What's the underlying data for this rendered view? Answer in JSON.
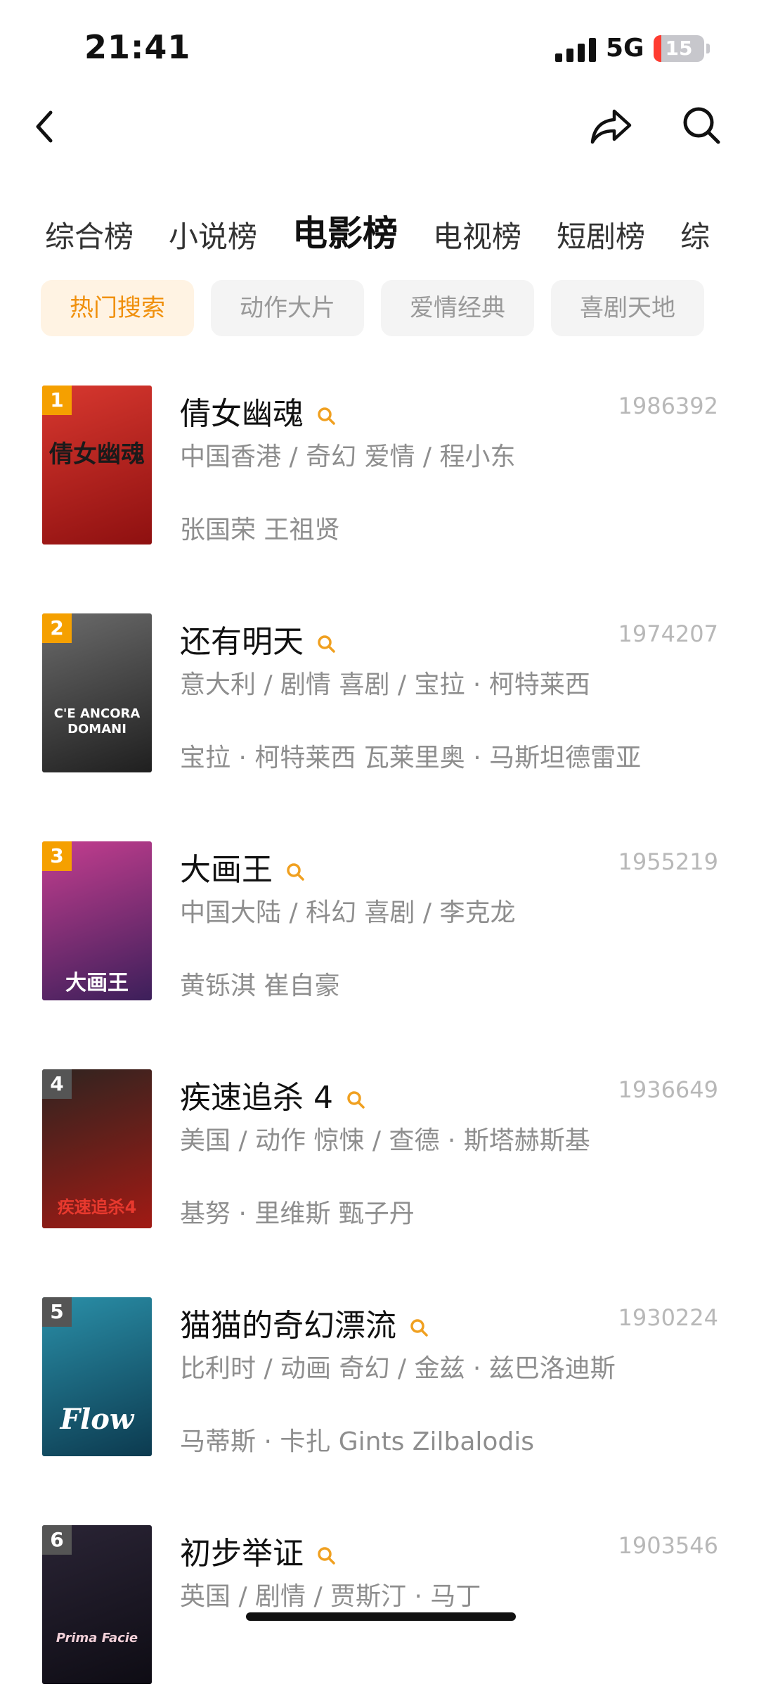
{
  "status_bar": {
    "time": "21:41",
    "network": "5G",
    "battery": "15",
    "battery_level": 0.15
  },
  "nav": {
    "back_icon": "chevron-left-icon",
    "share_icon": "share-icon",
    "search_icon": "search-icon"
  },
  "tabs": [
    {
      "label": "综合榜",
      "active": false
    },
    {
      "label": "小说榜",
      "active": false
    },
    {
      "label": "电影榜",
      "active": true
    },
    {
      "label": "电视榜",
      "active": false
    },
    {
      "label": "短剧榜",
      "active": false
    },
    {
      "label": "综",
      "active": false
    }
  ],
  "filters": [
    {
      "label": "热门搜索",
      "active": true
    },
    {
      "label": "动作大片",
      "active": false
    },
    {
      "label": "爱情经典",
      "active": false
    },
    {
      "label": "喜剧天地",
      "active": false
    }
  ],
  "colors": {
    "accent": "#f0900c",
    "rank_top": "#f5a000",
    "rank_other": "#555555"
  },
  "movies": [
    {
      "rank": "1",
      "title": "倩女幽魂",
      "count": "1986392",
      "meta": "中国香港 / 奇幻 爱情 / 程小东",
      "cast": "张国荣 王祖贤",
      "poster_text": "倩女幽魂",
      "poster_colors": [
        "#d8382f",
        "#8e1010"
      ]
    },
    {
      "rank": "2",
      "title": "还有明天",
      "count": "1974207",
      "meta": "意大利 / 剧情 喜剧 / 宝拉 · 柯特莱西",
      "cast": "宝拉 · 柯特莱西 瓦莱里奥 · 马斯坦德雷亚",
      "poster_text": "C'E ANCORA DOMANI",
      "poster_colors": [
        "#6b6b6b",
        "#1f1f1f"
      ]
    },
    {
      "rank": "3",
      "title": "大画王",
      "count": "1955219",
      "meta": "中国大陆 / 科幻 喜剧 / 李克龙",
      "cast": "黄铄淇 崔自豪",
      "poster_text": "大画王",
      "poster_colors": [
        "#c43e8f",
        "#3c1f5a"
      ]
    },
    {
      "rank": "4",
      "title": "疾速追杀 4",
      "count": "1936649",
      "meta": "美国 / 动作 惊悚 / 查德 · 斯塔赫斯基",
      "cast": "基努 · 里维斯 甄子丹",
      "poster_text": "疾速追杀4",
      "poster_colors": [
        "#2f2420",
        "#a11a14"
      ]
    },
    {
      "rank": "5",
      "title": "猫猫的奇幻漂流",
      "count": "1930224",
      "meta": "比利时 / 动画 奇幻 / 金兹 · 兹巴洛迪斯",
      "cast": "马蒂斯 · 卡扎 Gints Zilbalodis",
      "poster_text": "Flow",
      "poster_colors": [
        "#2a8fa8",
        "#0c3a4f"
      ]
    },
    {
      "rank": "6",
      "title": "初步举证",
      "count": "1903546",
      "meta": "英国 / 剧情 / 贾斯汀 · 马丁",
      "cast": "",
      "poster_text": "Prima Facie",
      "poster_colors": [
        "#2a2435",
        "#0e0c14"
      ]
    }
  ]
}
